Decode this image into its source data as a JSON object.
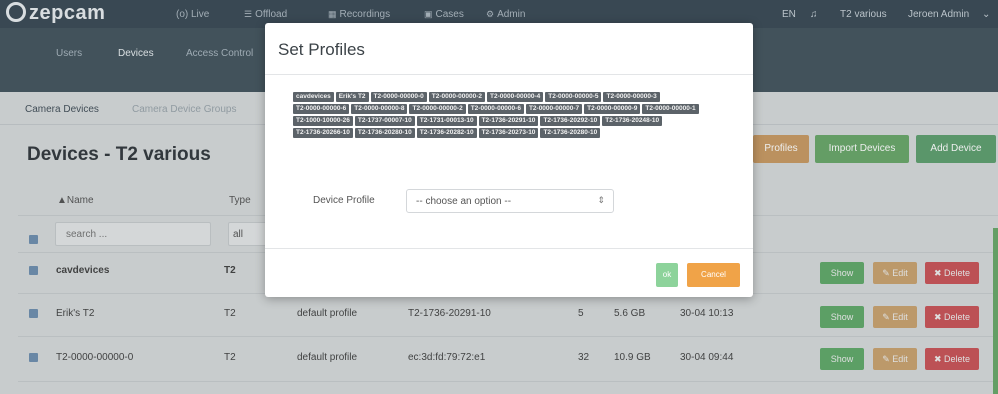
{
  "app": {
    "logo_text": "zepcam",
    "nav": [
      {
        "label": "(o) Live",
        "icon": "live-icon"
      },
      {
        "label": "Offload",
        "icon": "offload-icon"
      },
      {
        "label": "Recordings",
        "icon": "recordings-icon"
      },
      {
        "label": "Cases",
        "icon": "cases-icon"
      },
      {
        "label": "Admin",
        "icon": "admin-icon"
      }
    ],
    "lang": "EN",
    "org": "T2 various",
    "user": "Jeroen Admin"
  },
  "subnav": {
    "tabs": [
      "Users",
      "Devices",
      "Access Control"
    ]
  },
  "content": {
    "tabs": [
      "Camera Devices",
      "Camera Device Groups"
    ],
    "title": "Devices - T2 various",
    "buttons": {
      "profiles": "Profiles",
      "import": "Import Devices",
      "add": "Add Device"
    },
    "columns": {
      "name": "▲Name",
      "type": "Type"
    },
    "search_placeholder": "search ...",
    "type_filter": "all",
    "rows": [
      {
        "name": "cavdevices",
        "type": "T2",
        "profile": "",
        "serial": "",
        "count": "",
        "size": "",
        "date": ""
      },
      {
        "name": "Erik's T2",
        "type": "T2",
        "profile": "default profile",
        "serial": "T2-1736-20291-10",
        "count": "5",
        "size": "5.6 GB",
        "date": "30-04 10:13"
      },
      {
        "name": "T2-0000-00000-0",
        "type": "T2",
        "profile": "default profile",
        "serial": "ec:3d:fd:79:72:e1",
        "count": "32",
        "size": "10.9 GB",
        "date": "30-04 09:44"
      }
    ],
    "row_actions": {
      "show": "Show",
      "edit": "✎ Edit",
      "delete": "✖ Delete"
    }
  },
  "modal": {
    "title": "Set Profiles",
    "selected_devices": [
      "cavdevices",
      "Erik's T2",
      "T2-0000-00000-0",
      "T2-0000-00000-2",
      "T2-0000-00000-4",
      "T2-0000-00000-5",
      "T2-0000-00000-3",
      "T2-0000-00000-6",
      "T2-0000-00000-8",
      "T2-0000-00000-2",
      "T2-0000-00000-6",
      "T2-0000-00000-7",
      "T2-0000-00000-9",
      "T2-0000-00000-1",
      "T2-1000-10000-26",
      "T2-1737-00007-10",
      "T2-1731-00013-10",
      "T2-1736-20291-10",
      "T2-1736-20292-10",
      "T2-1736-20248-10",
      "T2-1736-20266-10",
      "T2-1736-20280-10",
      "T2-1736-20282-10",
      "T2-1736-20273-10",
      "T2-1736-20280-10"
    ],
    "profile_label": "Device Profile",
    "profile_select_value": "-- choose an option --",
    "ok_label": "ok",
    "cancel_label": "Cancel"
  }
}
